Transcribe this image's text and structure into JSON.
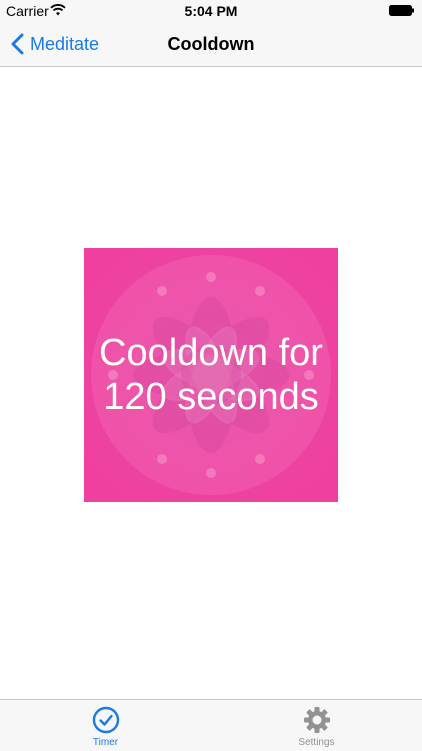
{
  "status_bar": {
    "carrier": "Carrier",
    "time": "5:04 PM",
    "icons": [
      "wifi-icon",
      "battery-icon"
    ]
  },
  "nav": {
    "back_label": "Meditate",
    "title": "Cooldown",
    "back_icon": "chevron-left-icon"
  },
  "card": {
    "text": "Cooldown for 120 seconds",
    "background_color": "#ec3f9e"
  },
  "tabs": [
    {
      "label": "Timer",
      "icon": "clock-icon",
      "selected": true
    },
    {
      "label": "Settings",
      "icon": "gear-icon",
      "selected": false
    }
  ],
  "colors": {
    "accent": "#1a7ae6",
    "inactive": "#929292",
    "bar_background": "#f7f7f7"
  }
}
